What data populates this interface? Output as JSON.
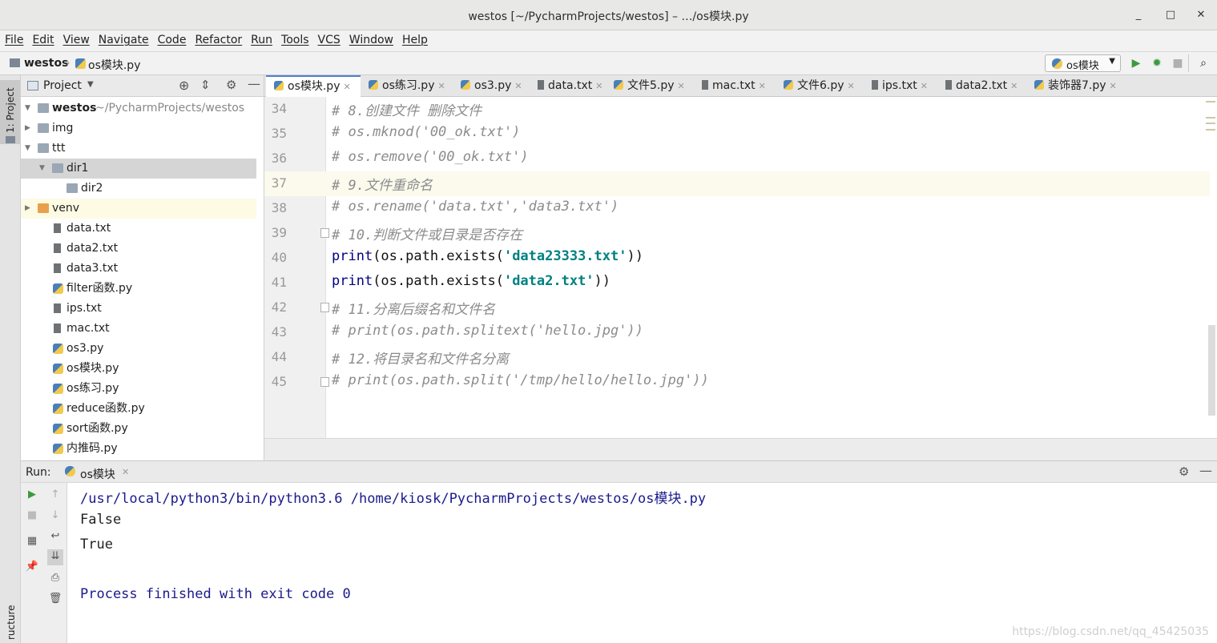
{
  "window": {
    "title": "westos [~/PycharmProjects/westos] – …/os模块.py",
    "minimize": "_",
    "maximize": "□",
    "close": "✕"
  },
  "menu": [
    "File",
    "Edit",
    "View",
    "Navigate",
    "Code",
    "Refactor",
    "Run",
    "Tools",
    "VCS",
    "Window",
    "Help"
  ],
  "navbar": {
    "project": "westos",
    "file": "os模块.py",
    "run_config": "os模块"
  },
  "sidebar": {
    "project_tab": "1: Project",
    "structure_tab": "ructure"
  },
  "project_panel": {
    "title": "Project",
    "root_name": "westos",
    "root_path": "~/PycharmProjects/westos",
    "tree": [
      {
        "label": "img",
        "kind": "folder",
        "depth": 1,
        "expanded": false
      },
      {
        "label": "ttt",
        "kind": "folder",
        "depth": 1,
        "expanded": true
      },
      {
        "label": "dir1",
        "kind": "folder",
        "depth": 2,
        "expanded": true,
        "selected": true
      },
      {
        "label": "dir2",
        "kind": "folder",
        "depth": 3
      },
      {
        "label": "venv",
        "kind": "venv",
        "depth": 1,
        "expanded": false,
        "highlight": true
      },
      {
        "label": "data.txt",
        "kind": "file",
        "depth": 1
      },
      {
        "label": "data2.txt",
        "kind": "file",
        "depth": 1
      },
      {
        "label": "data3.txt",
        "kind": "file",
        "depth": 1
      },
      {
        "label": "filter函数.py",
        "kind": "py",
        "depth": 1
      },
      {
        "label": "ips.txt",
        "kind": "file",
        "depth": 1
      },
      {
        "label": "mac.txt",
        "kind": "file",
        "depth": 1
      },
      {
        "label": "os3.py",
        "kind": "py",
        "depth": 1
      },
      {
        "label": "os模块.py",
        "kind": "py",
        "depth": 1
      },
      {
        "label": "os练习.py",
        "kind": "py",
        "depth": 1
      },
      {
        "label": "reduce函数.py",
        "kind": "py",
        "depth": 1
      },
      {
        "label": "sort函数.py",
        "kind": "py",
        "depth": 1
      },
      {
        "label": "内推码.py",
        "kind": "py",
        "depth": 1
      }
    ]
  },
  "tabs": [
    {
      "label": "os模块.py",
      "kind": "py",
      "active": true
    },
    {
      "label": "os练习.py",
      "kind": "py"
    },
    {
      "label": "os3.py",
      "kind": "py"
    },
    {
      "label": "data.txt",
      "kind": "file"
    },
    {
      "label": "文件5.py",
      "kind": "py"
    },
    {
      "label": "mac.txt",
      "kind": "file"
    },
    {
      "label": "文件6.py",
      "kind": "py"
    },
    {
      "label": "ips.txt",
      "kind": "file"
    },
    {
      "label": "data2.txt",
      "kind": "file"
    },
    {
      "label": "装饰器7.py",
      "kind": "py"
    }
  ],
  "code_lines": [
    {
      "num": "34",
      "parts": [
        {
          "t": "# 8.创建文件 删除文件",
          "c": "comment"
        }
      ]
    },
    {
      "num": "35",
      "parts": [
        {
          "t": "# os.mknod('00_ok.txt')",
          "c": "comment"
        }
      ]
    },
    {
      "num": "36",
      "parts": [
        {
          "t": "# os.remove('00_ok.txt')",
          "c": "comment"
        }
      ]
    },
    {
      "num": "37",
      "parts": [
        {
          "t": "# 9.文件重命名",
          "c": "comment"
        }
      ],
      "current": true
    },
    {
      "num": "38",
      "parts": [
        {
          "t": "# os.rename('data.txt','data3.txt')",
          "c": "comment"
        }
      ]
    },
    {
      "num": "39",
      "parts": [
        {
          "t": "# 10.判断文件或目录是否存在",
          "c": "comment"
        }
      ],
      "fold": true
    },
    {
      "num": "40",
      "parts": [
        {
          "t": "print",
          "c": "kw"
        },
        {
          "t": "(os.path.exists(",
          "c": "plain"
        },
        {
          "t": "'data23333.txt'",
          "c": "str"
        },
        {
          "t": "))",
          "c": "plain"
        }
      ]
    },
    {
      "num": "41",
      "parts": [
        {
          "t": "print",
          "c": "kw"
        },
        {
          "t": "(os.path.exists(",
          "c": "plain"
        },
        {
          "t": "'data2.txt'",
          "c": "str"
        },
        {
          "t": "))",
          "c": "plain"
        }
      ]
    },
    {
      "num": "42",
      "parts": [
        {
          "t": "# 11.分离后缀名和文件名",
          "c": "comment"
        }
      ],
      "fold": true
    },
    {
      "num": "43",
      "parts": [
        {
          "t": "# print(os.path.splitext('hello.jpg'))",
          "c": "comment"
        }
      ]
    },
    {
      "num": "44",
      "parts": [
        {
          "t": "# 12.将目录名和文件名分离",
          "c": "comment"
        }
      ]
    },
    {
      "num": "45",
      "parts": [
        {
          "t": "# print(os.path.split('/tmp/hello/hello.jpg'))",
          "c": "comment"
        }
      ],
      "fold": true
    }
  ],
  "run_panel": {
    "label": "Run:",
    "tab": "os模块",
    "output": [
      {
        "text": "/usr/local/python3/bin/python3.6 /home/kiosk/PycharmProjects/westos/os模块.py",
        "color": "#1a1a8c"
      },
      {
        "text": "False",
        "color": "#222222"
      },
      {
        "text": "True",
        "color": "#222222"
      },
      {
        "text": "",
        "color": "#222222"
      },
      {
        "text": "Process finished with exit code 0",
        "color": "#1a1a8c"
      }
    ]
  },
  "watermark": "https://blog.csdn.net/qq_45425035",
  "colors": {
    "accent": "#4e7fcc",
    "run_green": "#3c9a3c"
  }
}
